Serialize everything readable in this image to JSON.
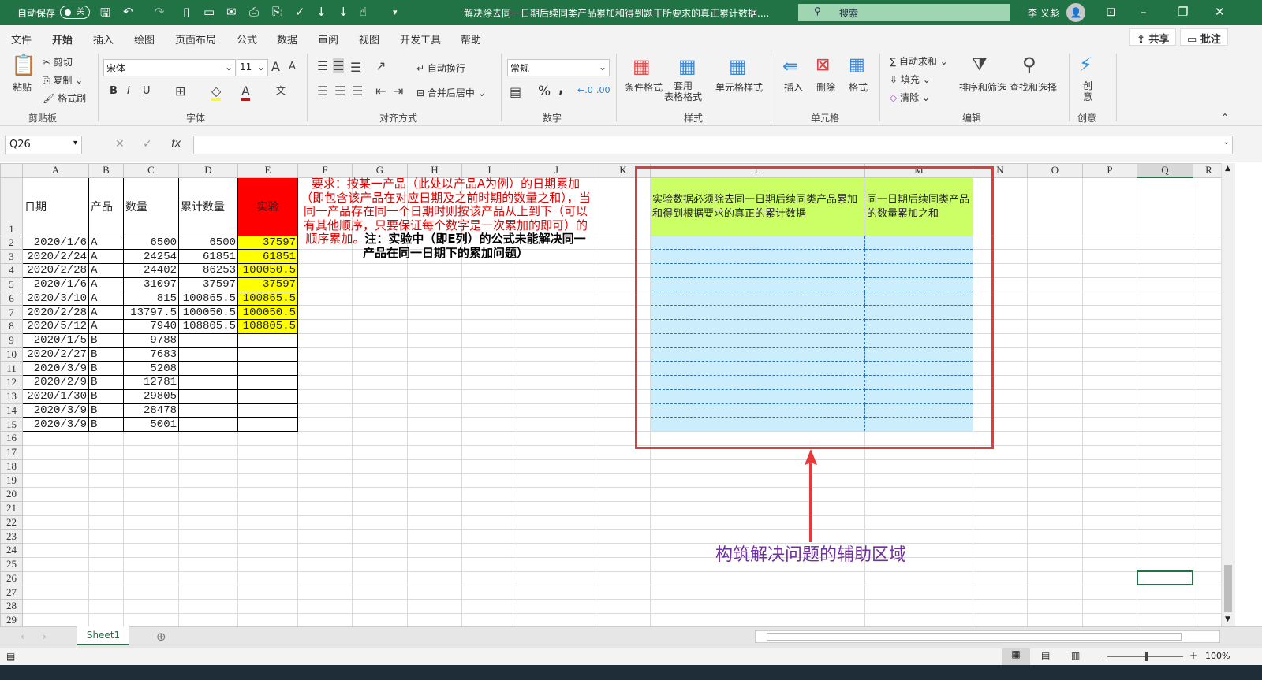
{
  "titlebar": {
    "autosave_label": "自动保存",
    "autosave_state": "关",
    "doc_title": "解决除去同一日期后续同类产品累加和得到题干所要求的真正累计数据....",
    "search_placeholder": "搜索",
    "user_name": "李 义彪"
  },
  "menu": {
    "tabs": [
      "文件",
      "开始",
      "插入",
      "绘图",
      "页面布局",
      "公式",
      "数据",
      "审阅",
      "视图",
      "开发工具",
      "帮助"
    ],
    "share": "共享",
    "comment": "批注"
  },
  "ribbon": {
    "clipboard": {
      "paste": "粘贴",
      "cut": "剪切",
      "copy": "复制",
      "format_painter": "格式刷",
      "label": "剪贴板"
    },
    "font": {
      "name": "宋体",
      "size": "11",
      "bold": "B",
      "italic": "I",
      "underline": "U",
      "label": "字体"
    },
    "alignment": {
      "wrap": "自动换行",
      "merge": "合并后居中",
      "label": "对齐方式"
    },
    "number": {
      "format": "常规",
      "percent": "%",
      "comma": ",",
      "label": "数字"
    },
    "styles": {
      "conditional": "条件格式",
      "table_format": "套用\n表格格式",
      "cell_styles": "单元格样式",
      "label": "样式"
    },
    "cells": {
      "insert": "插入",
      "delete": "删除",
      "format": "格式",
      "label": "单元格"
    },
    "editing": {
      "autosum": "自动求和",
      "fill": "填充",
      "clear": "清除",
      "sort_filter": "排序和筛选",
      "find_select": "查找和选择",
      "label": "编辑"
    },
    "ideas": {
      "ideas": "创\n意",
      "label": "创意"
    }
  },
  "formula_bar": {
    "name_box": "Q26",
    "fx": "fx",
    "value": ""
  },
  "columns": [
    "A",
    "B",
    "C",
    "D",
    "E",
    "F",
    "G",
    "H",
    "I",
    "J",
    "K",
    "L",
    "M",
    "N",
    "O",
    "P",
    "Q",
    "R"
  ],
  "selected_column": "Q",
  "rows": [
    {
      "A": "日期",
      "B": "产品",
      "C": "数量",
      "D": "累计数量",
      "E": "实验"
    },
    {
      "A": "2020/1/6",
      "B": "A",
      "C": "6500",
      "D": "6500",
      "E": "37597"
    },
    {
      "A": "2020/2/24",
      "B": "A",
      "C": "24254",
      "D": "61851",
      "E": "61851"
    },
    {
      "A": "2020/2/28",
      "B": "A",
      "C": "24402",
      "D": "86253",
      "E": "100050.5"
    },
    {
      "A": "2020/1/6",
      "B": "A",
      "C": "31097",
      "D": "37597",
      "E": "37597"
    },
    {
      "A": "2020/3/10",
      "B": "A",
      "C": "815",
      "D": "100865.5",
      "E": "100865.5"
    },
    {
      "A": "2020/2/28",
      "B": "A",
      "C": "13797.5",
      "D": "100050.5",
      "E": "100050.5"
    },
    {
      "A": "2020/5/12",
      "B": "A",
      "C": "7940",
      "D": "108805.5",
      "E": "108805.5"
    },
    {
      "A": "2020/1/5",
      "B": "B",
      "C": "9788"
    },
    {
      "A": "2020/2/27",
      "B": "B",
      "C": "7683"
    },
    {
      "A": "2020/3/9",
      "B": "B",
      "C": "5208"
    },
    {
      "A": "2020/2/9",
      "B": "B",
      "C": "12781"
    },
    {
      "A": "2020/1/30",
      "B": "B",
      "C": "29805"
    },
    {
      "A": "2020/3/9",
      "B": "B",
      "C": "28478"
    },
    {
      "A": "2020/3/9",
      "B": "B",
      "C": "5001"
    }
  ],
  "row_count": 29,
  "helper": {
    "L1": "实验数据必须除去同一日期后续同类产品累加和得到根据要求的真正的累计数据",
    "M1": "同一日期后续同类产品的数量累加之和"
  },
  "requirement": {
    "red": "要求：按某一产品（此处以产品A为例）的日期累加（即包含该产品在对应日期及之前时期的数量之和），当同一产品存在同一个日期时则按该产品从上到下（可以有其他顺序，只要保证每个数字是一次累加的即可）的顺序累加。",
    "black": "注：实验中（即E列）的公式未能解决同一产品在同一日期下的累加问题）"
  },
  "annotation": "构筑解决问题的辅助区域",
  "sheets": [
    "Sheet1"
  ],
  "status": {
    "zoom": "100%"
  },
  "colors": {
    "excel_green": "#217346",
    "highlight_red": "#ff0000",
    "highlight_yellow": "#ffff00",
    "helper_green": "#ccff66",
    "helper_blue": "#cceefc",
    "annotation_purple": "#7030a0"
  }
}
